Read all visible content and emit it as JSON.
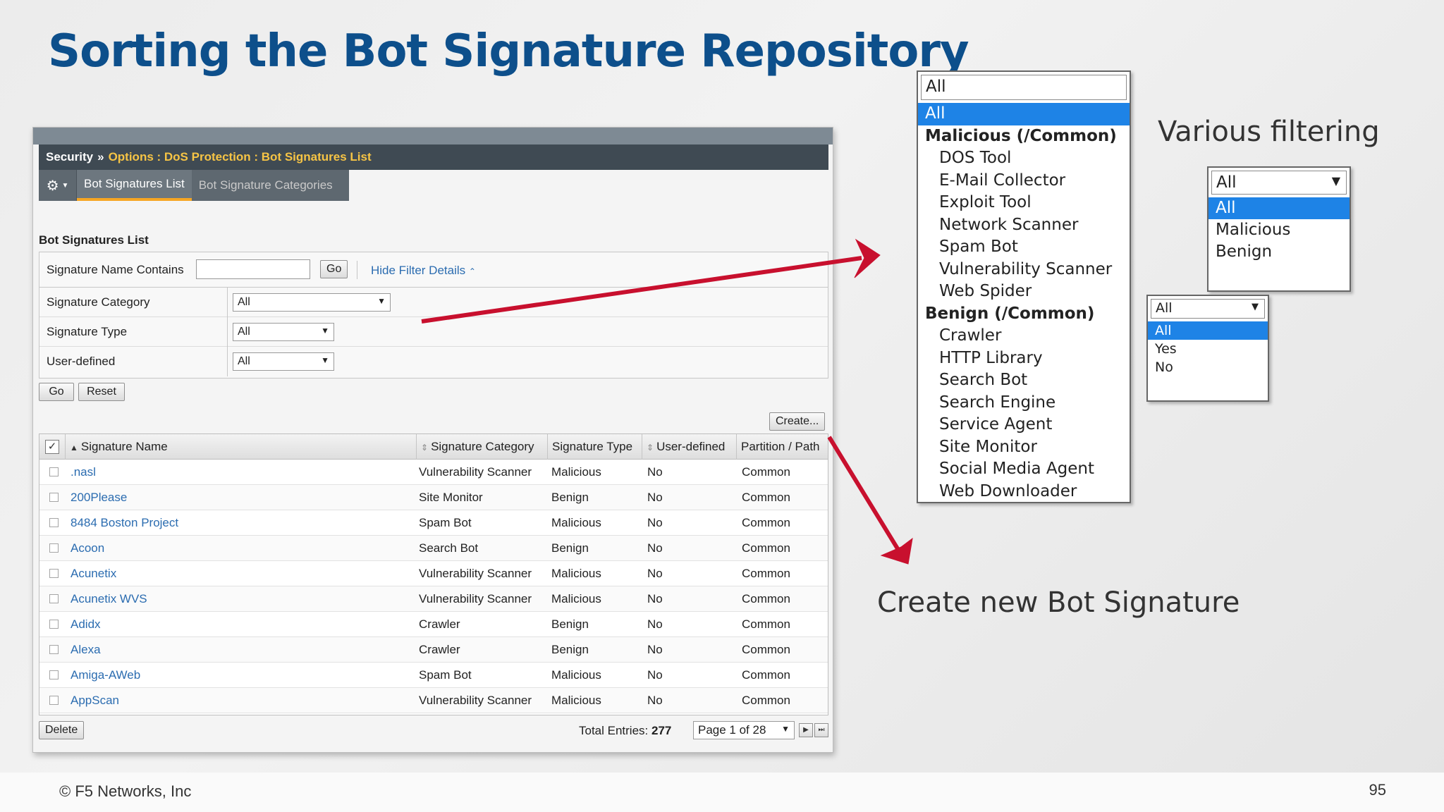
{
  "slide": {
    "title": "Sorting the Bot Signature Repository",
    "footer": "© F5 Networks, Inc",
    "page_number": "95",
    "callout_filtering": "Various filtering",
    "callout_create": "Create new Bot Signature",
    "arrow_color": "#c8102e"
  },
  "breadcrumb": {
    "root": "Security",
    "separator": "»",
    "path": "Options : DoS Protection : Bot Signatures List"
  },
  "tabs": [
    {
      "label": "Bot Signatures List",
      "active": true
    },
    {
      "label": "Bot Signature Categories",
      "active": false
    }
  ],
  "list_title": "Bot Signatures List",
  "filter": {
    "name_label": "Signature Name Contains",
    "name_value": "",
    "go_label": "Go",
    "hide_label": "Hide Filter Details",
    "category_label": "Signature Category",
    "category_value": "All",
    "type_label": "Signature Type",
    "type_value": "All",
    "userdef_label": "User-defined",
    "userdef_value": "All",
    "go_button": "Go",
    "reset_button": "Reset"
  },
  "create_button": "Create...",
  "table": {
    "columns": [
      "Signature Name",
      "Signature Category",
      "Signature Type",
      "User-defined",
      "Partition / Path"
    ],
    "rows": [
      {
        "name": ".nasl",
        "category": "Vulnerability Scanner",
        "type": "Malicious",
        "user_defined": "No",
        "partition": "Common"
      },
      {
        "name": "200Please",
        "category": "Site Monitor",
        "type": "Benign",
        "user_defined": "No",
        "partition": "Common"
      },
      {
        "name": "8484 Boston Project",
        "category": "Spam Bot",
        "type": "Malicious",
        "user_defined": "No",
        "partition": "Common"
      },
      {
        "name": "Acoon",
        "category": "Search Bot",
        "type": "Benign",
        "user_defined": "No",
        "partition": "Common"
      },
      {
        "name": "Acunetix",
        "category": "Vulnerability Scanner",
        "type": "Malicious",
        "user_defined": "No",
        "partition": "Common"
      },
      {
        "name": "Acunetix WVS",
        "category": "Vulnerability Scanner",
        "type": "Malicious",
        "user_defined": "No",
        "partition": "Common"
      },
      {
        "name": "Adidx",
        "category": "Crawler",
        "type": "Benign",
        "user_defined": "No",
        "partition": "Common"
      },
      {
        "name": "Alexa",
        "category": "Crawler",
        "type": "Benign",
        "user_defined": "No",
        "partition": "Common"
      },
      {
        "name": "Amiga-AWeb",
        "category": "Spam Bot",
        "type": "Malicious",
        "user_defined": "No",
        "partition": "Common"
      },
      {
        "name": "AppScan",
        "category": "Vulnerability Scanner",
        "type": "Malicious",
        "user_defined": "No",
        "partition": "Common"
      }
    ]
  },
  "footer_bar": {
    "delete_button": "Delete",
    "total_label": "Total Entries:",
    "total_value": "277",
    "page_select": "Page 1 of 28"
  },
  "category_dropdown": {
    "current": "All",
    "options": [
      {
        "label": "All",
        "kind": "selected"
      },
      {
        "label": "Malicious (/Common)",
        "kind": "group"
      },
      {
        "label": "DOS Tool",
        "kind": "child"
      },
      {
        "label": "E-Mail Collector",
        "kind": "child"
      },
      {
        "label": "Exploit Tool",
        "kind": "child"
      },
      {
        "label": "Network Scanner",
        "kind": "child"
      },
      {
        "label": "Spam Bot",
        "kind": "child"
      },
      {
        "label": "Vulnerability Scanner",
        "kind": "child"
      },
      {
        "label": "Web Spider",
        "kind": "child"
      },
      {
        "label": "Benign (/Common)",
        "kind": "group"
      },
      {
        "label": "Crawler",
        "kind": "child"
      },
      {
        "label": "HTTP Library",
        "kind": "child"
      },
      {
        "label": "Search Bot",
        "kind": "child"
      },
      {
        "label": "Search Engine",
        "kind": "child"
      },
      {
        "label": "Service Agent",
        "kind": "child"
      },
      {
        "label": "Site Monitor",
        "kind": "child"
      },
      {
        "label": "Social Media Agent",
        "kind": "child"
      },
      {
        "label": "Web Downloader",
        "kind": "child"
      }
    ]
  },
  "type_dropdown": {
    "current": "All",
    "options": [
      {
        "label": "All",
        "kind": "selected"
      },
      {
        "label": "Malicious",
        "kind": "plain"
      },
      {
        "label": "Benign",
        "kind": "plain"
      }
    ]
  },
  "userdef_dropdown": {
    "current": "All",
    "options": [
      {
        "label": "All",
        "kind": "selected"
      },
      {
        "label": "Yes",
        "kind": "plain"
      },
      {
        "label": "No",
        "kind": "plain"
      }
    ]
  }
}
